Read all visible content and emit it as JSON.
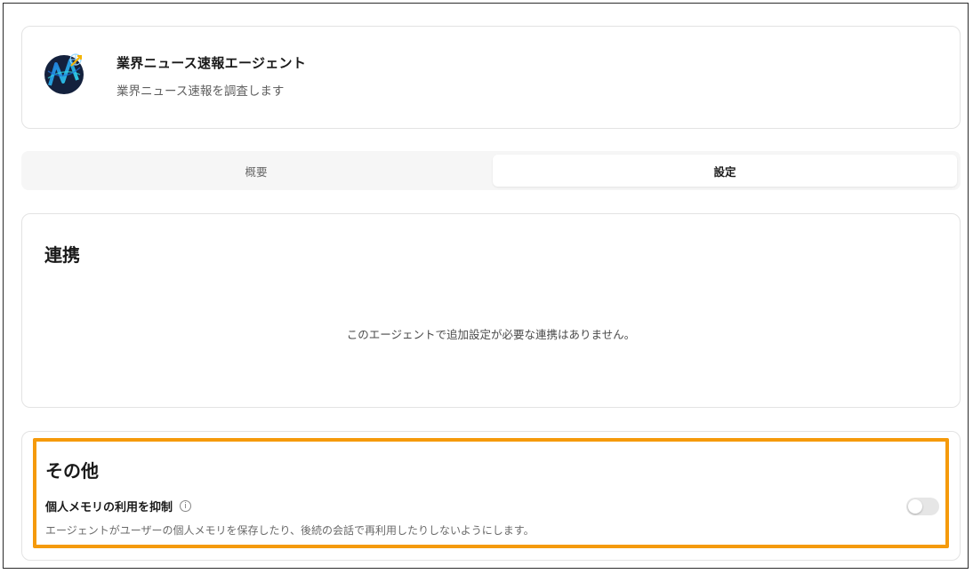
{
  "agent": {
    "name": "業界ニュース速報エージェント",
    "description": "業界ニュース速報を調査します"
  },
  "tabs": [
    {
      "label": "概要",
      "active": false
    },
    {
      "label": "設定",
      "active": true
    }
  ],
  "integrations": {
    "title": "連携",
    "empty_message": "このエージェントで追加設定が必要な連携はありません。"
  },
  "other": {
    "title": "その他",
    "setting_label": "個人メモリの利用を抑制",
    "setting_description": "エージェントがユーザーの個人メモリを保存したり、後続の会話で再利用したりしないようにします。",
    "toggle_on": false
  },
  "colors": {
    "highlight": "#f59a0b",
    "avatar_bg": "#1b2a4a",
    "avatar_accent": "#2fd6e0"
  }
}
